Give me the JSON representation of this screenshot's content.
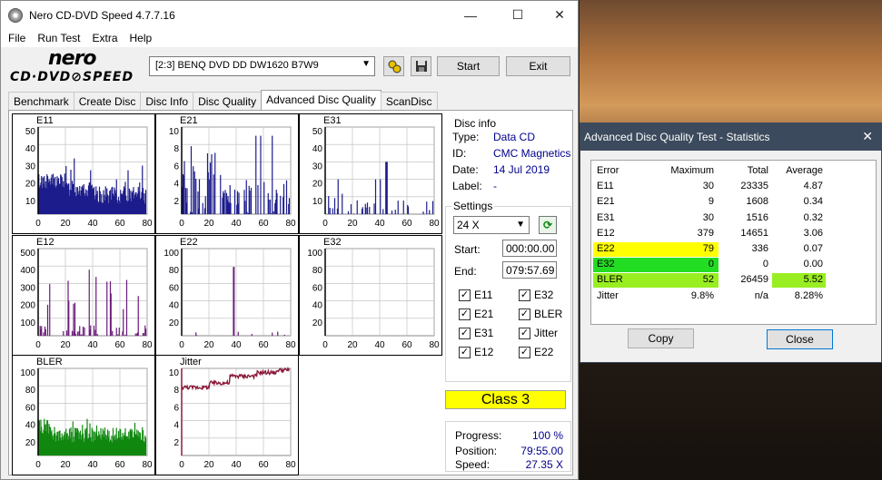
{
  "window": {
    "title": "Nero CD-DVD Speed 4.7.7.16",
    "minimize": "—",
    "maximize": "☐",
    "close": "✕"
  },
  "menu": [
    "File",
    "Run Test",
    "Extra",
    "Help"
  ],
  "logo": {
    "top": "nero",
    "bottom": "CD·DVD⊘SPEED"
  },
  "toolbar": {
    "drive": "[2:3]   BENQ DVD DD DW1620 B7W9",
    "start": "Start",
    "exit": "Exit"
  },
  "tabs": [
    "Benchmark",
    "Create Disc",
    "Disc Info",
    "Disc Quality",
    "Advanced Disc Quality",
    "ScanDisc"
  ],
  "active_tab": "Advanced Disc Quality",
  "disc_info": {
    "heading": "Disc info",
    "type_label": "Type:",
    "type": "Data CD",
    "id_label": "ID:",
    "id": "CMC Magnetics",
    "date_label": "Date:",
    "date": "14 Jul 2019",
    "label_label": "Label:",
    "label": "-"
  },
  "settings": {
    "heading": "Settings",
    "speed": "24 X",
    "start_label": "Start:",
    "start": "000:00.00",
    "end_label": "End:",
    "end": "079:57.69",
    "checks": [
      {
        "label": "E11",
        "checked": true
      },
      {
        "label": "E32",
        "checked": true
      },
      {
        "label": "E21",
        "checked": true
      },
      {
        "label": "BLER",
        "checked": true
      },
      {
        "label": "E31",
        "checked": true
      },
      {
        "label": "Jitter",
        "checked": true
      },
      {
        "label": "E12",
        "checked": true
      },
      {
        "label": "E22",
        "checked": true
      }
    ]
  },
  "class_label": "Class 3",
  "progress": {
    "progress_label": "Progress:",
    "progress": "100 %",
    "position_label": "Position:",
    "position": "79:55.00",
    "speed_label": "Speed:",
    "speed": "27.35 X"
  },
  "chart_data": [
    {
      "type": "bar",
      "title": "E11",
      "y_ticks": [
        "50",
        "40",
        "30",
        "20",
        "10"
      ],
      "x_ticks": [
        "0",
        "20",
        "40",
        "60",
        "80"
      ],
      "ylim": [
        0,
        50
      ],
      "xlim": [
        0,
        80
      ],
      "color": "#1c1c8c",
      "profile": "e11"
    },
    {
      "type": "bar",
      "title": "E21",
      "y_ticks": [
        "10",
        "8",
        "6",
        "4",
        "2"
      ],
      "x_ticks": [
        "0",
        "20",
        "40",
        "60",
        "80"
      ],
      "ylim": [
        0,
        10
      ],
      "xlim": [
        0,
        80
      ],
      "color": "#1c1c8c",
      "profile": "e21"
    },
    {
      "type": "bar",
      "title": "E31",
      "y_ticks": [
        "50",
        "40",
        "30",
        "20",
        "10"
      ],
      "x_ticks": [
        "0",
        "20",
        "40",
        "60",
        "80"
      ],
      "ylim": [
        0,
        50
      ],
      "xlim": [
        0,
        80
      ],
      "color": "#1c1c8c",
      "profile": "e31"
    },
    {
      "type": "bar",
      "title": "E12",
      "y_ticks": [
        "500",
        "400",
        "300",
        "200",
        "100"
      ],
      "x_ticks": [
        "0",
        "20",
        "40",
        "60",
        "80"
      ],
      "ylim": [
        0,
        500
      ],
      "xlim": [
        0,
        80
      ],
      "color": "#6a1a7a",
      "profile": "e12"
    },
    {
      "type": "bar",
      "title": "E22",
      "y_ticks": [
        "100",
        "80",
        "60",
        "40",
        "20"
      ],
      "x_ticks": [
        "0",
        "20",
        "40",
        "60",
        "80"
      ],
      "ylim": [
        0,
        100
      ],
      "xlim": [
        0,
        80
      ],
      "color": "#6a1a7a",
      "profile": "e22"
    },
    {
      "type": "bar",
      "title": "E32",
      "y_ticks": [
        "100",
        "80",
        "60",
        "40",
        "20"
      ],
      "x_ticks": [
        "0",
        "20",
        "40",
        "60",
        "80"
      ],
      "ylim": [
        0,
        100
      ],
      "xlim": [
        0,
        80
      ],
      "color": "#6a1a7a",
      "profile": "empty"
    },
    {
      "type": "bar",
      "title": "BLER",
      "y_ticks": [
        "100",
        "80",
        "60",
        "40",
        "20"
      ],
      "x_ticks": [
        "0",
        "20",
        "40",
        "60",
        "80"
      ],
      "ylim": [
        0,
        100
      ],
      "xlim": [
        0,
        80
      ],
      "color": "#118811",
      "profile": "bler"
    },
    {
      "type": "line",
      "title": "Jitter",
      "y_ticks": [
        "10",
        "8",
        "6",
        "4",
        "2"
      ],
      "x_ticks": [
        "0",
        "20",
        "40",
        "60",
        "80"
      ],
      "ylim": [
        0,
        10
      ],
      "xlim": [
        0,
        80
      ],
      "color": "#8b1a3a",
      "profile": "jitter"
    }
  ],
  "stats": {
    "title": "Advanced Disc Quality Test - Statistics",
    "close_x": "✕",
    "headers": [
      "Error",
      "Maximum",
      "Total",
      "Average"
    ],
    "rows": [
      [
        "E11",
        "30",
        "23335",
        "4.87"
      ],
      [
        "E21",
        "9",
        "1608",
        "0.34"
      ],
      [
        "E31",
        "30",
        "1516",
        "0.32"
      ],
      [
        "E12",
        "379",
        "14651",
        "3.06"
      ],
      [
        "E22",
        "79",
        "336",
        "0.07"
      ],
      [
        "E32",
        "0",
        "0",
        "0.00"
      ],
      [
        "BLER",
        "52",
        "26459",
        "5.52"
      ],
      [
        "Jitter",
        "9.8%",
        "n/a",
        "8.28%"
      ]
    ],
    "copy": "Copy",
    "close": "Close"
  }
}
